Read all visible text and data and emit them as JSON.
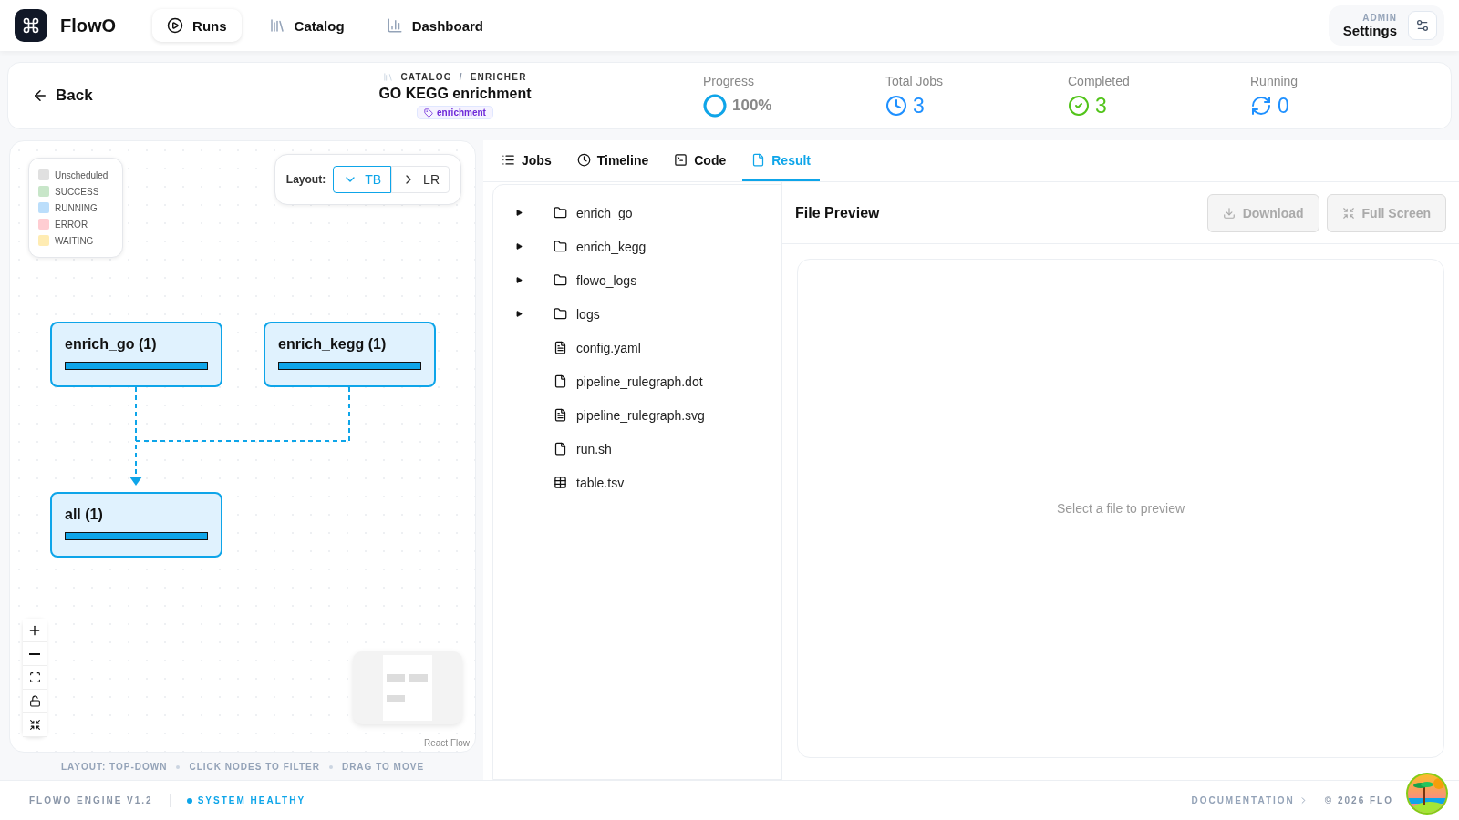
{
  "brand": "FlowO",
  "nav": [
    {
      "label": "Runs",
      "selected": true
    },
    {
      "label": "Catalog",
      "selected": false
    },
    {
      "label": "Dashboard",
      "selected": false
    }
  ],
  "admin": {
    "caption": "ADMIN",
    "label": "Settings"
  },
  "header": {
    "back": "Back",
    "breadcrumb": [
      "CATALOG",
      "ENRICHER"
    ],
    "separator": "/",
    "title": "GO KEGG enrichment",
    "tag": "enrichment"
  },
  "stats": [
    {
      "label": "Progress",
      "kind": "progress",
      "value": "100%",
      "level": 1
    },
    {
      "label": "Total Jobs",
      "kind": "total",
      "value": "3"
    },
    {
      "label": "Completed",
      "kind": "done",
      "value": "3"
    },
    {
      "label": "Running",
      "kind": "running",
      "value": "0"
    }
  ],
  "legend": [
    {
      "label": "Unscheduled",
      "color": "#e0e0e0"
    },
    {
      "label": "SUCCESS",
      "color": "#c8e6c9"
    },
    {
      "label": "RUNNING",
      "color": "#bbdefb"
    },
    {
      "label": "ERROR",
      "color": "#ffcdd2"
    },
    {
      "label": "WAITING",
      "color": "#ffecb3"
    }
  ],
  "layout": {
    "label": "Layout:",
    "options": [
      {
        "label": "TB",
        "selected": true
      },
      {
        "label": "LR",
        "selected": false
      }
    ]
  },
  "nodes": [
    {
      "label": "enrich_go (1)",
      "level": 1
    },
    {
      "label": "enrich_kegg (1)",
      "level": 1
    },
    {
      "label": "all (1)",
      "level": 1
    }
  ],
  "attribution": "React Flow",
  "hints": [
    "LAYOUT: TOP-DOWN",
    "CLICK NODES TO FILTER",
    "DRAG TO MOVE"
  ],
  "tabs": [
    {
      "label": "Jobs",
      "selected": false
    },
    {
      "label": "Timeline",
      "selected": false
    },
    {
      "label": "Code",
      "selected": false
    },
    {
      "label": "Result",
      "selected": true
    }
  ],
  "files": [
    {
      "name": "enrich_go",
      "kind": "folder",
      "expanded": false
    },
    {
      "name": "enrich_kegg",
      "kind": "folder",
      "expanded": false
    },
    {
      "name": "flowo_logs",
      "kind": "folder",
      "expanded": false
    },
    {
      "name": "logs",
      "kind": "folder",
      "expanded": false
    },
    {
      "name": "config.yaml",
      "kind": "text"
    },
    {
      "name": "pipeline_rulegraph.dot",
      "kind": "file"
    },
    {
      "name": "pipeline_rulegraph.svg",
      "kind": "text"
    },
    {
      "name": "run.sh",
      "kind": "file"
    },
    {
      "name": "table.tsv",
      "kind": "table"
    }
  ],
  "preview": {
    "title": "File Preview",
    "buttons": [
      {
        "label": "Download",
        "disabled": true
      },
      {
        "label": "Full Screen",
        "disabled": true
      }
    ],
    "empty": "Select a file to preview"
  },
  "footer": {
    "version": "FLOWO ENGINE V1.2",
    "status": "SYSTEM HEALTHY",
    "docs": "DOCUMENTATION",
    "copyright": "© 2026 FLO"
  }
}
